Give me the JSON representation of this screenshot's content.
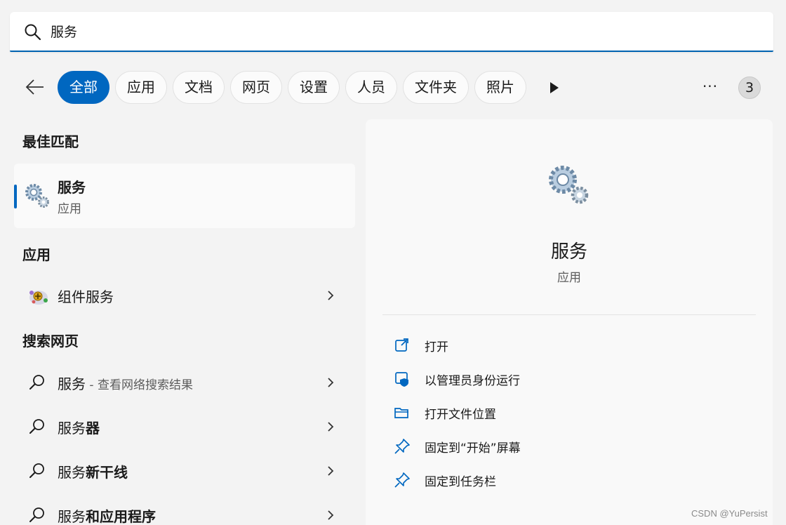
{
  "search": {
    "value": "服务"
  },
  "filters": {
    "chips": [
      "全部",
      "应用",
      "文档",
      "网页",
      "设置",
      "人员",
      "文件夹",
      "照片"
    ],
    "active_index": 0,
    "badge_count": "3",
    "more_label": "···"
  },
  "left": {
    "best_match_title": "最佳匹配",
    "best_match": {
      "name": "服务",
      "type": "应用"
    },
    "apps_title": "应用",
    "apps": [
      {
        "name": "组件服务"
      }
    ],
    "web_title": "搜索网页",
    "web_results": [
      {
        "prefix": "服务",
        "bold": "",
        "hint": " - 查看网络搜索结果"
      },
      {
        "prefix": "服务",
        "bold": "器",
        "hint": ""
      },
      {
        "prefix": "服务",
        "bold": "新干线",
        "hint": ""
      },
      {
        "prefix": "服务",
        "bold": "和应用程序",
        "hint": ""
      }
    ]
  },
  "detail": {
    "title": "服务",
    "subtitle": "应用",
    "actions": [
      {
        "label": "打开",
        "icon": "open-external-icon"
      },
      {
        "label": "以管理员身份运行",
        "icon": "shield-icon"
      },
      {
        "label": "打开文件位置",
        "icon": "folder-icon"
      },
      {
        "label": "固定到“开始”屏幕",
        "icon": "pin-icon"
      },
      {
        "label": "固定到任务栏",
        "icon": "pin-icon"
      }
    ]
  },
  "watermark": "CSDN @YuPersist",
  "colors": {
    "accent": "#0067c0",
    "background": "#f3f3f3"
  }
}
